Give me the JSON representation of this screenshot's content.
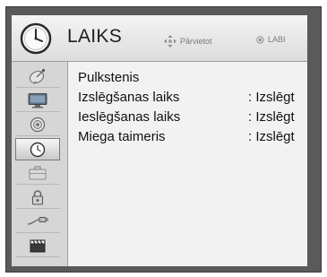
{
  "header": {
    "title": "LAIKS",
    "hint_move_icon": "four-arrows-icon",
    "hint_move_label": "Pārvietot",
    "hint_ok_icon": "ok-dot-icon",
    "hint_ok_label": "LABI",
    "menu_icon": "clock-icon"
  },
  "sidebar": {
    "items": [
      {
        "icon": "satellite-dish-icon"
      },
      {
        "icon": "monitor-icon"
      },
      {
        "icon": "speaker-icon"
      },
      {
        "icon": "clock-icon",
        "selected": true
      },
      {
        "icon": "toolbox-icon"
      },
      {
        "icon": "padlock-icon"
      },
      {
        "icon": "cable-plug-icon"
      },
      {
        "icon": "clapperboard-icon"
      }
    ]
  },
  "menu": {
    "rows": [
      {
        "label": "Pulkstenis",
        "value": ""
      },
      {
        "label": "Izslēgšanas laiks",
        "value": ": Izslēgt"
      },
      {
        "label": "Ieslēgšanas laiks",
        "value": ": Izslēgt"
      },
      {
        "label": "Miega taimeris",
        "value": ": Izslēgt"
      }
    ]
  },
  "colors": {
    "frame": "#5a5a5a",
    "header_bg": "#e8e8e8",
    "sidebar_bg": "#d6d6d6",
    "content_bg": "#f2f2f2",
    "text": "#111111"
  }
}
